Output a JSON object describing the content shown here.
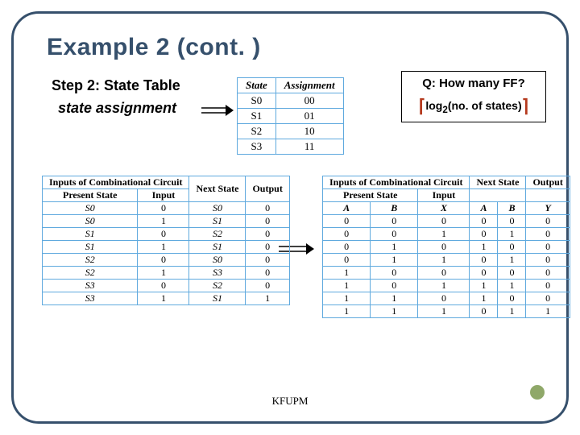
{
  "title": "Example 2 (cont. )",
  "step_label": "Step 2: State Table",
  "state_assignment_label": "state assignment",
  "qbox": {
    "question": "Q: How many FF?",
    "answer_inner": "log",
    "answer_sub": "2",
    "answer_paren": "(no. of states)"
  },
  "assignment_table": {
    "headers": [
      "State",
      "Assignment"
    ],
    "rows": [
      [
        "S0",
        "00"
      ],
      [
        "S1",
        "01"
      ],
      [
        "S2",
        "10"
      ],
      [
        "S3",
        "11"
      ]
    ]
  },
  "left_table": {
    "group_headers": [
      "Inputs of Combinational Circuit",
      "Next State",
      "Output"
    ],
    "sub_headers": [
      "Present State",
      "Input",
      "",
      ""
    ],
    "rows": [
      [
        "S0",
        "0",
        "S0",
        "0"
      ],
      [
        "S0",
        "1",
        "S1",
        "0"
      ],
      [
        "S1",
        "0",
        "S2",
        "0"
      ],
      [
        "S1",
        "1",
        "S1",
        "0"
      ],
      [
        "S2",
        "0",
        "S0",
        "0"
      ],
      [
        "S2",
        "1",
        "S3",
        "0"
      ],
      [
        "S3",
        "0",
        "S2",
        "0"
      ],
      [
        "S3",
        "1",
        "S1",
        "1"
      ]
    ]
  },
  "right_table": {
    "group_headers": [
      "Inputs of Combinational Circuit",
      "Next State",
      "Output"
    ],
    "sub_headers_row1": [
      "Present State",
      "Input",
      "",
      ""
    ],
    "sub_headers_row2": [
      "A",
      "B",
      "X",
      "A",
      "B",
      "Y"
    ],
    "rows": [
      [
        "0",
        "0",
        "0",
        "0",
        "0",
        "0"
      ],
      [
        "0",
        "0",
        "1",
        "0",
        "1",
        "0"
      ],
      [
        "0",
        "1",
        "0",
        "1",
        "0",
        "0"
      ],
      [
        "0",
        "1",
        "1",
        "0",
        "1",
        "0"
      ],
      [
        "1",
        "0",
        "0",
        "0",
        "0",
        "0"
      ],
      [
        "1",
        "0",
        "1",
        "1",
        "1",
        "0"
      ],
      [
        "1",
        "1",
        "0",
        "1",
        "0",
        "0"
      ],
      [
        "1",
        "1",
        "1",
        "0",
        "1",
        "1"
      ]
    ]
  },
  "footer": "KFUPM"
}
